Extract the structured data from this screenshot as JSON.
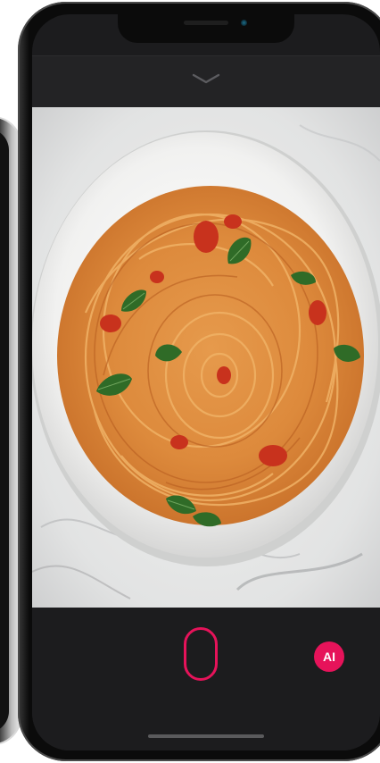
{
  "camera": {
    "collapse_icon": "chevron-down-icon",
    "photo_subject": "spaghetti-plate-icon",
    "ai_label": "AI",
    "accent_color": "#e6135a"
  }
}
